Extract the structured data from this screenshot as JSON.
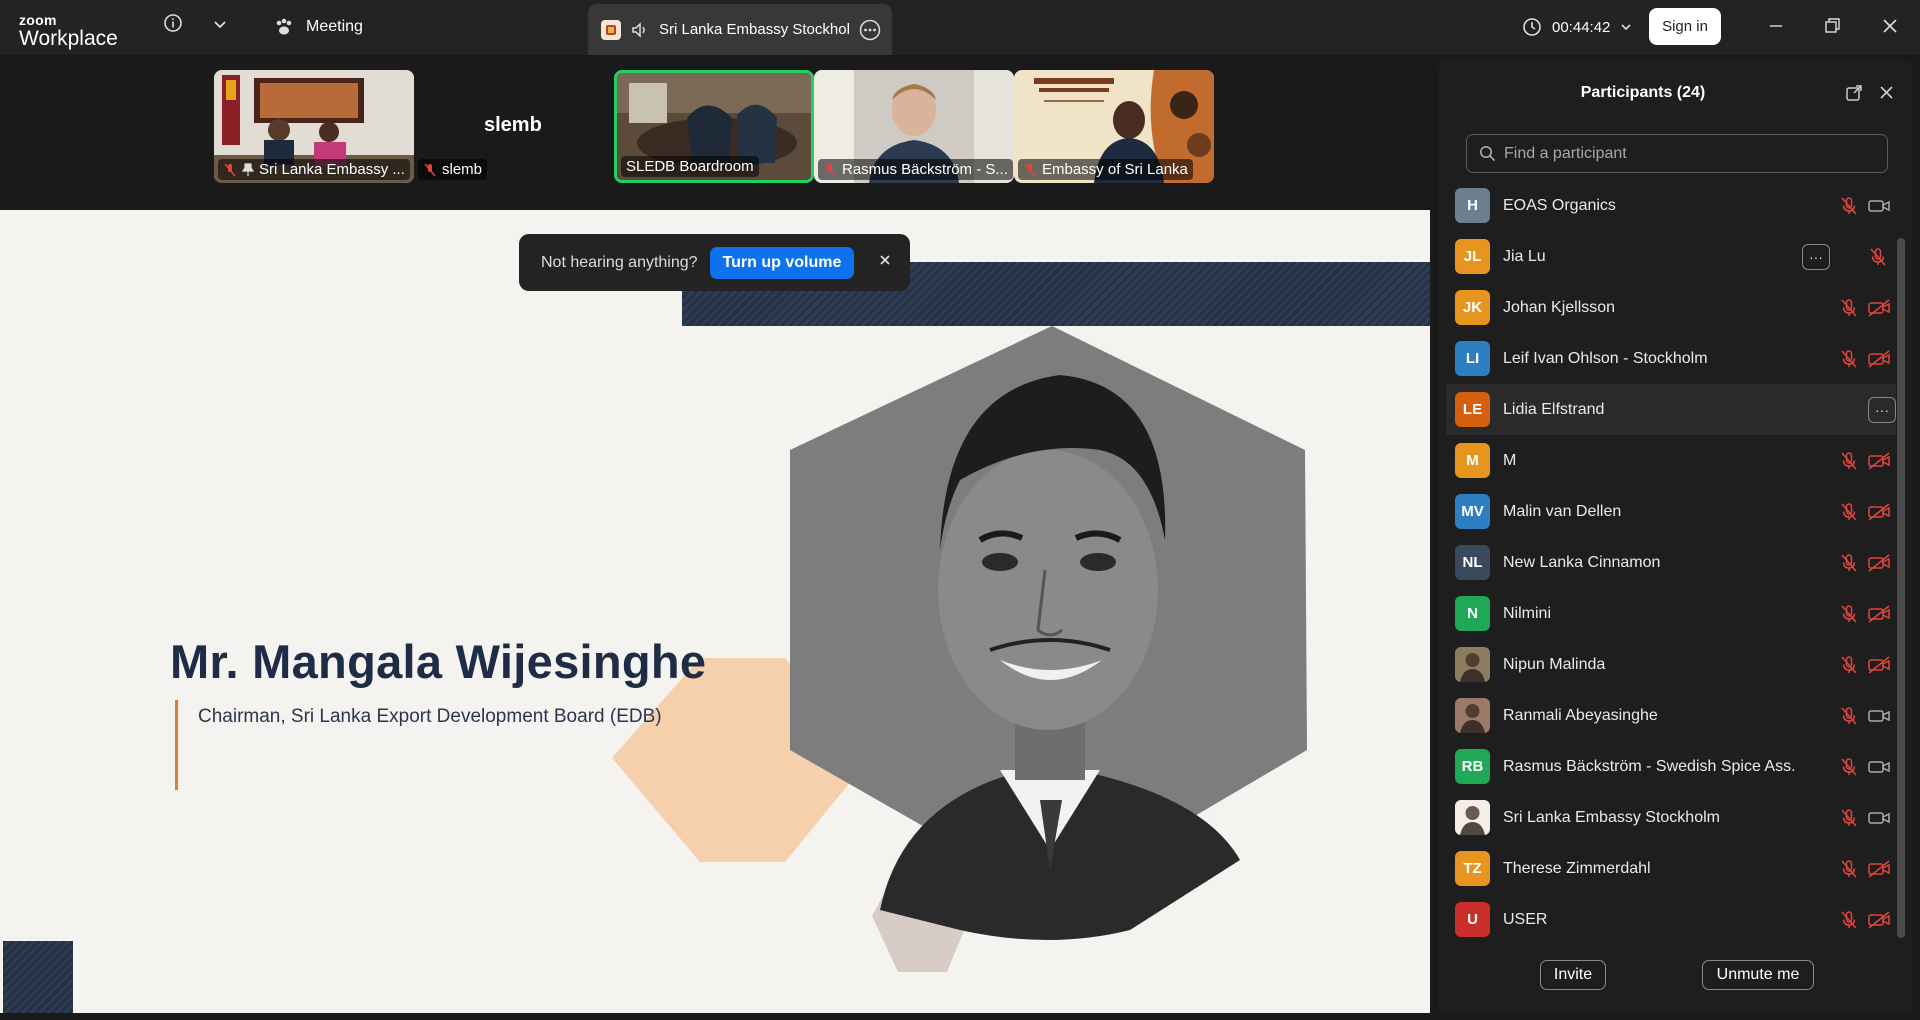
{
  "app": {
    "logo_top": "zoom",
    "logo_bottom": "Workplace"
  },
  "titlebar": {
    "meeting_label": "Meeting",
    "tab_title": "Sri Lanka Embassy Stockholm",
    "timer": "00:44:42",
    "sign_in": "Sign in"
  },
  "video_strip": {
    "tiles": [
      {
        "label": "Sri Lanka Embassy ...",
        "muted": true,
        "pinned": true
      },
      {
        "label": "slemb",
        "muted": true,
        "display_name": "slemb"
      },
      {
        "label": "SLEDB Boardroom",
        "muted": false,
        "active_speaker": true
      },
      {
        "label": "Rasmus Bäckström - S...",
        "muted": true
      },
      {
        "label": "Embassy of Sri Lanka",
        "muted": true
      }
    ]
  },
  "slide": {
    "name": "Mr. Mangala Wijesinghe",
    "role": "Chairman, Sri Lanka Export Development Board (EDB)"
  },
  "toast": {
    "message": "Not hearing anything?",
    "button": "Turn up volume"
  },
  "participants": {
    "title": "Participants (24)",
    "search_placeholder": "Find a participant",
    "items": [
      {
        "name": "EOAS Organics",
        "initials": "H",
        "color": "#6b7f8e",
        "mic": "muted",
        "cam": "on"
      },
      {
        "name": "Jia Lu",
        "initials": "JL",
        "color": "#e8951f",
        "mic": "muted",
        "cam": "none",
        "more": true
      },
      {
        "name": "Johan Kjellsson",
        "initials": "JK",
        "color": "#e8951f",
        "mic": "muted",
        "cam": "off"
      },
      {
        "name": "Leif Ivan Ohlson - Stockholm",
        "initials": "LI",
        "color": "#2d7fc1",
        "mic": "muted",
        "cam": "off"
      },
      {
        "name": "Lidia Elfstrand",
        "initials": "LE",
        "color": "#d35f0f",
        "mic": "none",
        "cam": "none",
        "more": true,
        "hover": true
      },
      {
        "name": "M",
        "initials": "M",
        "color": "#e8951f",
        "mic": "muted",
        "cam": "off"
      },
      {
        "name": "Malin van Dellen",
        "initials": "MV",
        "color": "#2d7fc1",
        "mic": "muted",
        "cam": "off"
      },
      {
        "name": "New Lanka Cinnamon",
        "initials": "NL",
        "color": "#394a5c",
        "mic": "muted",
        "cam": "off"
      },
      {
        "name": "Nilmini",
        "initials": "N",
        "color": "#1fa855",
        "mic": "muted",
        "cam": "off"
      },
      {
        "name": "Nipun Malinda",
        "initials": "",
        "color": "#8a7d62",
        "mic": "muted",
        "cam": "off",
        "photo": true
      },
      {
        "name": "Ranmali Abeyasinghe",
        "initials": "",
        "color": "#9b7a6a",
        "mic": "muted",
        "cam": "on",
        "photo": true
      },
      {
        "name": "Rasmus Bäckström - Swedish Spice Ass.",
        "initials": "RB",
        "color": "#1fa855",
        "mic": "muted",
        "cam": "on"
      },
      {
        "name": "Sri Lanka Embassy Stockholm",
        "initials": "",
        "color": "#f4efe6",
        "mic": "muted",
        "cam": "on",
        "photo": true
      },
      {
        "name": "Therese Zimmerdahl",
        "initials": "TZ",
        "color": "#e8951f",
        "mic": "muted",
        "cam": "off"
      },
      {
        "name": "USER",
        "initials": "U",
        "color": "#c9302c",
        "mic": "muted",
        "cam": "off"
      }
    ],
    "invite": "Invite",
    "unmute": "Unmute me"
  },
  "colors": {
    "accent": "#0e72ed",
    "muted_red": "#e0443e",
    "speaker_green": "#23d160"
  }
}
